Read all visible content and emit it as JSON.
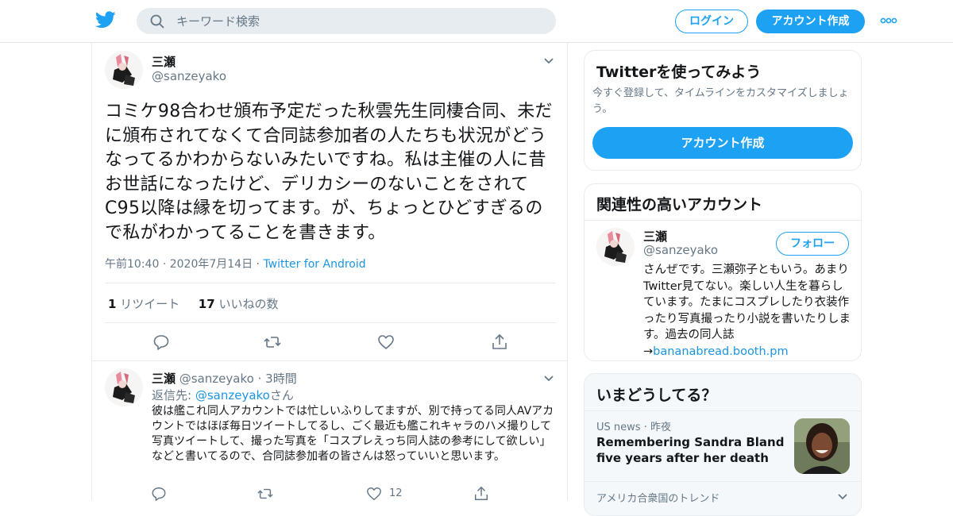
{
  "header": {
    "search_placeholder": "キーワード検索",
    "login_label": "ログイン",
    "signup_label": "アカウント作成"
  },
  "tweet": {
    "author_name": "三瀬",
    "author_handle": "@sanzeyako",
    "text": "コミケ98合わせ頒布予定だった秋雲先生同棲合同、未だに頒布されてなくて合同誌参加者の人たちも状況がどうなってるかわからないみたいですね。私は主催の人に昔お世話になったけど、デリカシーのないことをされてC95以降は縁を切ってます。が、ちょっとひどすぎるので私がわかってることを書きます。",
    "time": "午前10:40",
    "date": "2020年7月14日",
    "source": "Twitter for Android",
    "retweet_count": "1",
    "retweet_label": "リツイート",
    "like_count": "17",
    "like_label": "いいねの数"
  },
  "reply": {
    "author_name": "三瀬",
    "author_handle": "@sanzeyako",
    "time_ago": "3時間",
    "reply_to_prefix": "返信先: ",
    "reply_to_handle": "@sanzeyako",
    "reply_to_suffix": "さん",
    "text": "彼は艦これ同人アカウントでは忙しいふりしてますが、別で持ってる同人AVアカウントではほぼ毎日ツイートしてるし、ごく最近も艦これキャラのハメ撮りして写真ツイートして、撮った写真を「コスプレえっち同人誌の参考にして欲しい」などと書いてるので、合同誌参加者の皆さんは怒っていいと思います。",
    "like_count": "12"
  },
  "sidebar": {
    "signup_card": {
      "title": "Twitterを使ってみよう",
      "description": "今すぐ登録して、タイムラインをカスタマイズしましょう。",
      "button_label": "アカウント作成"
    },
    "related_card": {
      "title": "関連性の高いアカウント",
      "name": "三瀬",
      "handle": "@sanzeyako",
      "follow_label": "フォロー",
      "bio": "さんぜです。三瀬弥子ともいう。あまりTwitter見てない。楽しい人生を暮らしています。たまにコスプレしたり衣装作ったり写真撮ったり小説を書いたりします。過去の同人誌→",
      "bio_link": "bananabread.booth.pm"
    },
    "trends_card": {
      "title": "いまどうしてる？",
      "trend_meta_source": "US news",
      "trend_meta_time": "昨夜",
      "trend_headline": "Remembering Sandra Bland five years after her death",
      "next_label": "アメリカ合衆国のトレンド"
    }
  },
  "colors": {
    "brand": "#1da1f2",
    "link": "#1b95e0",
    "secondary_text": "#657786",
    "border": "#e6ecf0"
  }
}
